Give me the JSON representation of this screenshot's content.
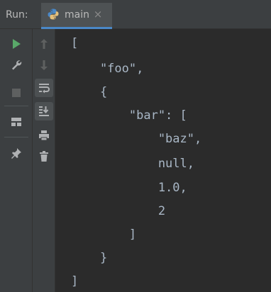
{
  "panel": {
    "run_label": "Run:",
    "tab": {
      "label": "main",
      "close": "×"
    }
  },
  "toolbar": {
    "left": [
      "run-icon",
      "wrench-icon",
      "stop-icon",
      "layout-icon",
      "pin-icon"
    ],
    "middle": [
      "up-arrow-icon",
      "down-arrow-icon",
      "soft-wrap-icon",
      "scroll-to-end-icon",
      "print-icon",
      "trash-icon"
    ]
  },
  "console": {
    "lines": [
      "[",
      "    \"foo\",",
      "    {",
      "        \"bar\": [",
      "            \"baz\",",
      "            null,",
      "            1.0,",
      "            2",
      "        ]",
      "    }",
      "]"
    ]
  },
  "colors": {
    "run_green": "#59a869",
    "accent_blue": "#4a88c7",
    "text": "#a9b7c6",
    "background": "#2b2b2b",
    "panel": "#3c3f41"
  }
}
